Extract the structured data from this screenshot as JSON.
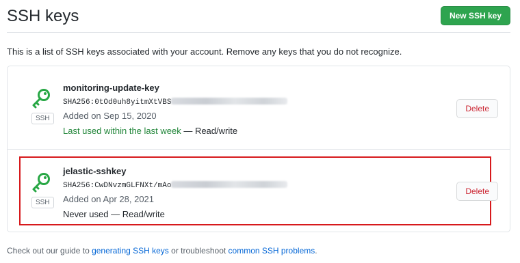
{
  "header": {
    "title": "SSH keys",
    "new_key_label": "New SSH key"
  },
  "intro": "This is a list of SSH keys associated with your account. Remove any keys that you do not recognize.",
  "keys": [
    {
      "name": "monitoring-update-key",
      "fingerprint_prefix": "SHA256:0tOd0uh8yitmXtVBS",
      "added": "Added on Sep 15, 2020",
      "usage_status": "Last used within the last week",
      "usage_access": " — Read/write",
      "badge": "SSH",
      "delete_label": "Delete",
      "icon": "key-icon"
    },
    {
      "name": "jelastic-sshkey",
      "fingerprint_prefix": "SHA256:CwDNvzmGLFNXt/mAo",
      "added": "Added on Apr 28, 2021",
      "usage_status": "Never used",
      "usage_access": " — Read/write",
      "badge": "SSH",
      "delete_label": "Delete",
      "icon": "key-icon"
    }
  ],
  "footer": {
    "prefix": "Check out our guide to ",
    "link1": "generating SSH keys",
    "middle": " or troubleshoot ",
    "link2": "common SSH problems",
    "suffix": "."
  },
  "colors": {
    "primary_button": "#2ea44f",
    "key_icon": "#28a745",
    "danger": "#cb2431",
    "recent_usage": "#22863a",
    "link": "#0366d6",
    "highlight": "#d7191c"
  }
}
